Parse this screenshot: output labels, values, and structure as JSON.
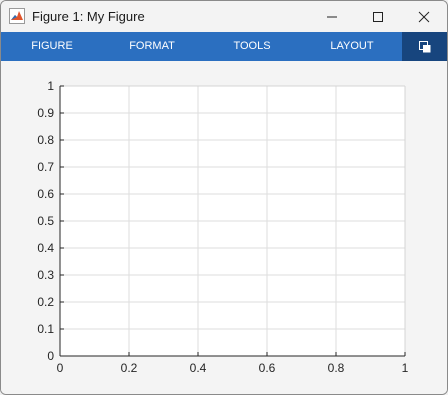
{
  "window": {
    "title": "Figure 1: My Figure",
    "icon": "matlab-logo-icon",
    "controls": [
      "minimize-icon",
      "maximize-icon",
      "close-icon"
    ]
  },
  "toolstrip": {
    "tabs": [
      {
        "label": "FIGURE"
      },
      {
        "label": "FORMAT"
      },
      {
        "label": "TOOLS"
      },
      {
        "label": "LAYOUT"
      }
    ],
    "undock_icon": "undock-icon",
    "colors": {
      "bar": "#2b6fc0",
      "active": "#17457e"
    }
  },
  "chart_data": {
    "type": "line",
    "series": [],
    "xlim": [
      0,
      1
    ],
    "ylim": [
      0,
      1
    ],
    "xticks": [
      0,
      0.2,
      0.4,
      0.6,
      0.8,
      1
    ],
    "yticks": [
      0,
      0.1,
      0.2,
      0.3,
      0.4,
      0.5,
      0.6,
      0.7,
      0.8,
      0.9,
      1
    ],
    "xtick_labels": [
      "0",
      "0.2",
      "0.4",
      "0.6",
      "0.8",
      "1"
    ],
    "ytick_labels": [
      "0",
      "0.1",
      "0.2",
      "0.3",
      "0.4",
      "0.5",
      "0.6",
      "0.7",
      "0.8",
      "0.9",
      "1"
    ],
    "grid": true,
    "title": "",
    "xlabel": "",
    "ylabel": ""
  }
}
